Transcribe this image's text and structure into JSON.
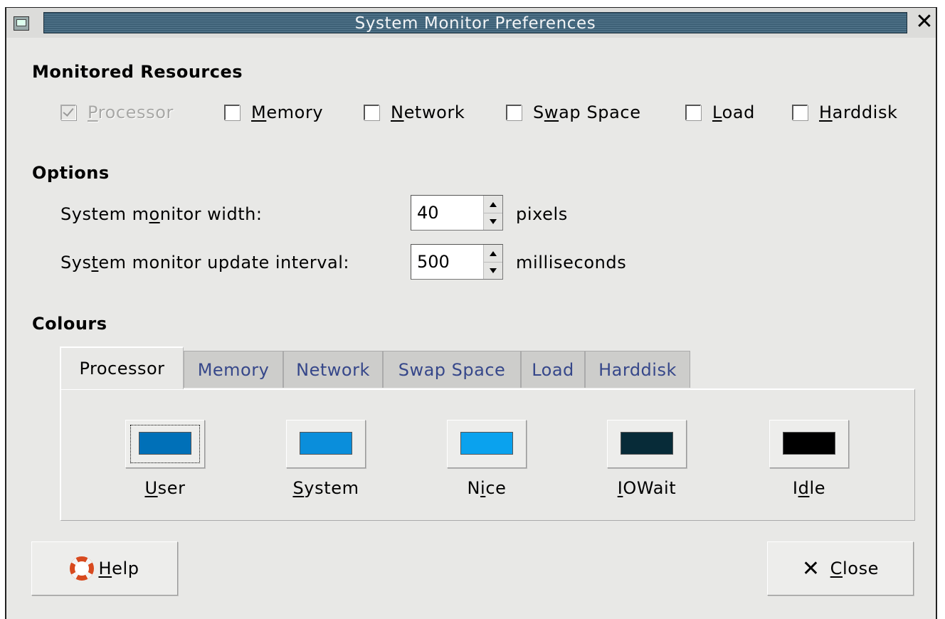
{
  "window": {
    "title": "System Monitor Preferences"
  },
  "sections": {
    "monitored": "Monitored Resources",
    "options": "Options",
    "colours": "Colours"
  },
  "resources": [
    {
      "pre": "",
      "key": "P",
      "post": "rocessor",
      "checked": true,
      "disabled": true
    },
    {
      "pre": "",
      "key": "M",
      "post": "emory",
      "checked": false,
      "disabled": false
    },
    {
      "pre": "",
      "key": "N",
      "post": "etwork",
      "checked": false,
      "disabled": false
    },
    {
      "pre": "S",
      "key": "w",
      "post": "ap Space",
      "checked": false,
      "disabled": false
    },
    {
      "pre": "",
      "key": "L",
      "post": "oad",
      "checked": false,
      "disabled": false
    },
    {
      "pre": "",
      "key": "H",
      "post": "arddisk",
      "checked": false,
      "disabled": false
    }
  ],
  "options": {
    "width": {
      "pre": "System m",
      "key": "o",
      "post": "nitor width:",
      "value": "40",
      "unit": "pixels"
    },
    "interval": {
      "pre": "Sys",
      "key": "t",
      "post": "em monitor update interval:",
      "value": "500",
      "unit": "milliseconds"
    }
  },
  "tabs": [
    "Processor",
    "Memory",
    "Network",
    "Swap Space",
    "Load",
    "Harddisk"
  ],
  "active_tab": "Processor",
  "colours": [
    {
      "pre": "",
      "key": "U",
      "post": "ser",
      "color": "#0070b8"
    },
    {
      "pre": "",
      "key": "S",
      "post": "ystem",
      "color": "#0a8edb"
    },
    {
      "pre": "N",
      "key": "i",
      "post": "ce",
      "color": "#0aa2ee"
    },
    {
      "pre": "",
      "key": "I",
      "post": "OWait",
      "color": "#072b38"
    },
    {
      "pre": "I",
      "key": "d",
      "post": "le",
      "color": "#000000"
    }
  ],
  "buttons": {
    "help": {
      "pre": "",
      "key": "H",
      "post": "elp",
      "icon": "lifebuoy-icon"
    },
    "close": {
      "pre": "",
      "key": "C",
      "post": "lose",
      "icon": "close-icon"
    }
  }
}
